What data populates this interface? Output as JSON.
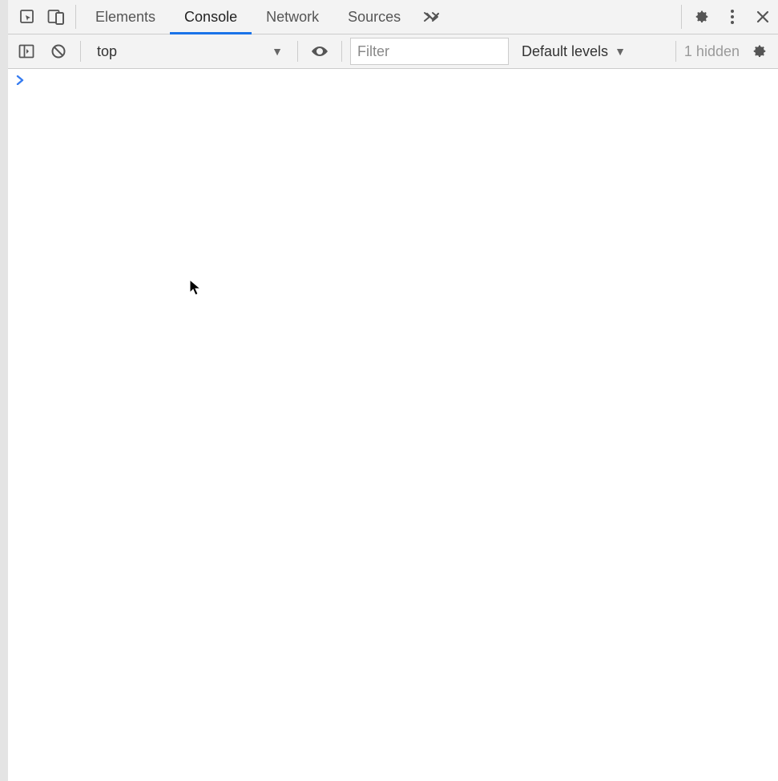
{
  "tabs": {
    "items": [
      {
        "label": "Elements",
        "active": false
      },
      {
        "label": "Console",
        "active": true
      },
      {
        "label": "Network",
        "active": false
      },
      {
        "label": "Sources",
        "active": false
      }
    ]
  },
  "toolbar": {
    "context": "top",
    "filter_placeholder": "Filter",
    "levels_label": "Default levels",
    "hidden_label": "1 hidden"
  },
  "console": {
    "prompt": ""
  }
}
